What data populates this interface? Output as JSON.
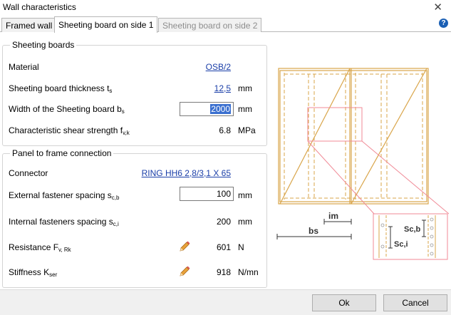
{
  "window": {
    "title": "Wall characteristics",
    "close_glyph": "✕"
  },
  "tabs": [
    {
      "label": "Framed wall",
      "state": "normal"
    },
    {
      "label": "Sheeting board on side 1",
      "state": "active"
    },
    {
      "label": "Sheeting board on side 2",
      "state": "disabled"
    }
  ],
  "help_glyph": "?",
  "sheeting": {
    "title": "Sheeting boards",
    "material": {
      "label": "Material",
      "value": "OSB/2"
    },
    "thickness": {
      "label": "Sheeting board thickness t",
      "sub": "s",
      "value": "12,5",
      "unit": "mm"
    },
    "width": {
      "label": "Width of the Sheeting board b",
      "sub": "s",
      "value": "2000",
      "unit": "mm"
    },
    "shear": {
      "label": "Characteristic shear strength f",
      "sub": "v,k",
      "value": "6.8",
      "unit": "MPa"
    }
  },
  "panel": {
    "title": "Panel to frame connection",
    "connector": {
      "label": "Connector",
      "value": "RING HH6 2,8/3,1 X 65"
    },
    "external": {
      "label": "External fastener spacing s",
      "sub": "c,b",
      "value": "100",
      "unit": "mm"
    },
    "internal": {
      "label": "Internal fasteners spacing s",
      "sub": "c,i",
      "value": "200",
      "unit": "mm"
    },
    "resistance": {
      "label": "Resistance F",
      "sub": "v, Rk",
      "value": "601",
      "unit": "N"
    },
    "stiffness": {
      "label": "Stiffness K",
      "sub": "ser",
      "value": "918",
      "unit": "N/mn"
    }
  },
  "diagram": {
    "label_im": "im",
    "label_bs": "bs",
    "label_scb": "Sc,b",
    "label_sci": "Sc,i"
  },
  "colors": {
    "frame": "#d9a54a",
    "detail": "#f08a96",
    "link": "#1a3ea8",
    "selection": "#3b70d0"
  },
  "footer": {
    "ok_label": "Ok",
    "cancel_label": "Cancel"
  }
}
